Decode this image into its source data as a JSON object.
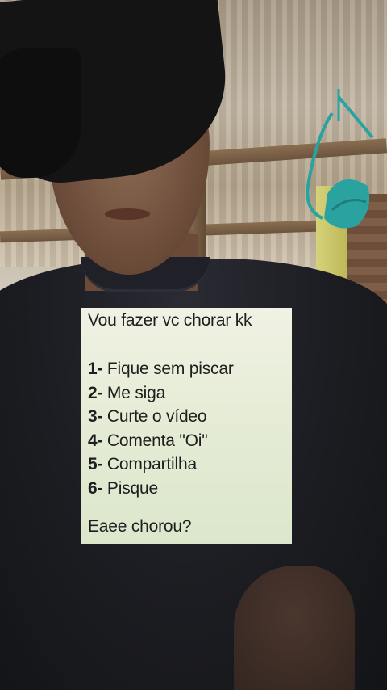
{
  "overlay": {
    "title": "Vou fazer vc chorar kk",
    "items": [
      {
        "num": "1-",
        "text": "Fique sem piscar"
      },
      {
        "num": "2-",
        "text": "Me siga"
      },
      {
        "num": "3-",
        "text": "Curte o vídeo"
      },
      {
        "num": "4-",
        "text": "Comenta \"Oi\""
      },
      {
        "num": "5-",
        "text": "Compartilha"
      },
      {
        "num": "6-",
        "text": "Pisque"
      }
    ],
    "footer": "Eaee chorou?"
  },
  "icons": {
    "hanging_item": "hanging-swimsuit-icon"
  },
  "colors": {
    "card_background": "#e6ecd6",
    "text": "#1e1e1e",
    "shirt": "#1c1d22",
    "hanging_item": "#2aa3a0"
  }
}
